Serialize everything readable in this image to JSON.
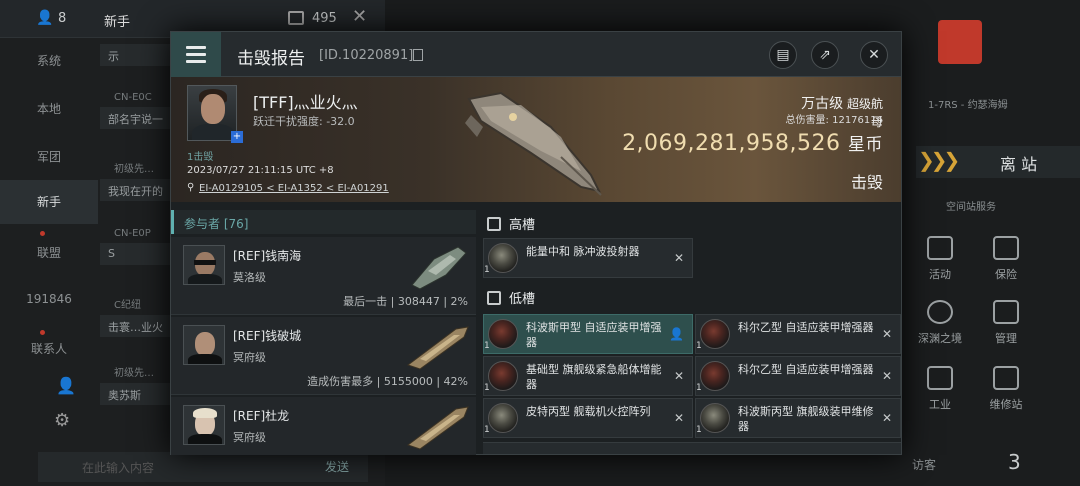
{
  "chat": {
    "header_count": "8",
    "channel_title": "新手",
    "mail_count": "495",
    "side": [
      "系统",
      "本地",
      "军团",
      "新手",
      "联盟",
      "191846",
      "联系人"
    ],
    "members": [
      {
        "name": "",
        "msg": "示"
      },
      {
        "name": "CN-E0C",
        "msg": "部名宇说一"
      },
      {
        "name": "初级先…",
        "msg": "我现在开的"
      },
      {
        "name": "CN-E0P",
        "msg": "S"
      },
      {
        "name": "C纪纽",
        "msg": "击寰…业火"
      },
      {
        "name": "初级先…",
        "msg": "奥苏斯"
      }
    ],
    "input_placeholder": "在此输入内容",
    "send_label": "发送"
  },
  "right": {
    "system": "1-7RS - 约瑟海姆",
    "undock": "离 站",
    "services": "空间站服务",
    "grid": [
      "活动",
      "保险",
      "深渊之境",
      "管理",
      "工业",
      "维修站"
    ],
    "visitors_label": "访客",
    "visitors_count": "3"
  },
  "modal": {
    "title": "击毁报告",
    "id": "[ID.10220891]",
    "victim": {
      "name": "[TFF]灬业火灬",
      "jam": "跃迁干扰强度: -32.0",
      "tag": "1击毁",
      "datetime": "2023/07/27 21:11:15 UTC +8",
      "path": "EI-A0129105 < EI-A1352 < EI-A01291"
    },
    "ship_name": "万古级",
    "ship_type": "超级航母",
    "total_damage_label": "总伤害量: 12176116",
    "value": "2,069,281,958,526",
    "value_unit": "星币",
    "result": "击毁",
    "participants_label": "参与者 [76]",
    "participants": [
      {
        "name": "[REF]钱南海",
        "ship": "莫洛级",
        "stats": "最后一击 | 308447 | 2%"
      },
      {
        "name": "[REF]钱破城",
        "ship": "冥府级",
        "stats": "造成伤害最多 | 5155000 | 42%"
      },
      {
        "name": "[REF]杜龙",
        "ship": "冥府级",
        "stats": ""
      }
    ],
    "high_label": "高槽",
    "low_label": "低槽",
    "high_slots": [
      {
        "qty": "1",
        "name": "能量中和 脉冲波投射器"
      }
    ],
    "low_slots_left": [
      {
        "qty": "1",
        "name": "科波斯甲型 自适应装甲增强器"
      },
      {
        "qty": "1",
        "name": "基础型 旗舰级紧急船体增能器"
      },
      {
        "qty": "1",
        "name": "皮特丙型 舰载机火控阵列"
      }
    ],
    "low_slots_right": [
      {
        "qty": "1",
        "name": "科尔乙型 自适应装甲增强器"
      },
      {
        "qty": "1",
        "name": "科尔乙型 自适应装甲增强器"
      },
      {
        "qty": "1",
        "name": "科波斯丙型 旗舰级装甲维修器"
      }
    ]
  }
}
